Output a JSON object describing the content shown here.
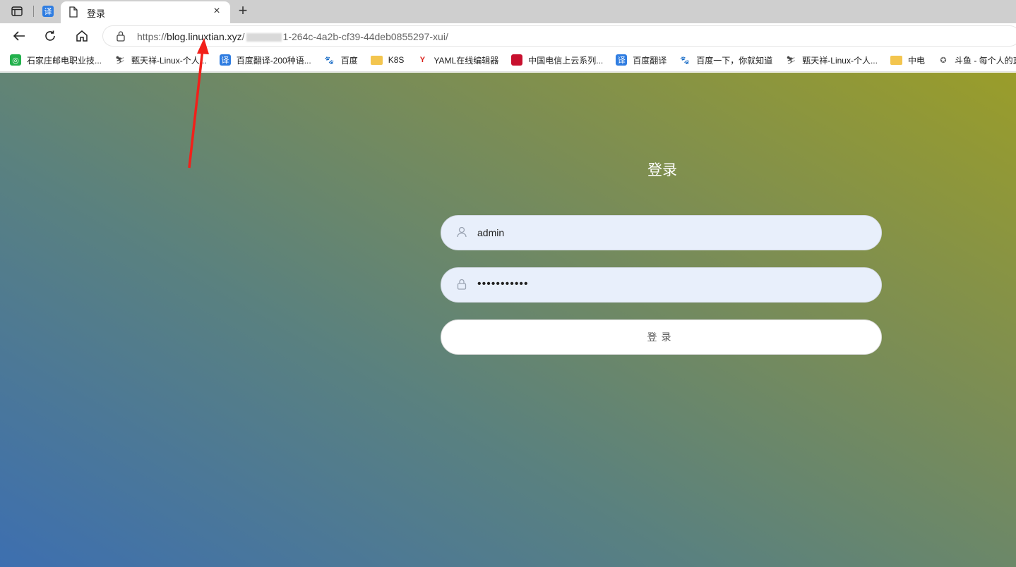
{
  "browser": {
    "tabs": [
      {
        "title": "登录",
        "active": true
      }
    ],
    "pinned_tab_icon": "translate-icon",
    "new_tab_symbol": "+",
    "close_symbol": "×",
    "address": {
      "scheme": "https://",
      "host": "blog.linuxtian.xyz",
      "path_start": "/",
      "path_end": "1-264c-4a2b-cf39-44deb0855297-xui/"
    },
    "bookmarks": [
      {
        "label": "石家庄邮电职业技...",
        "icon": "green-circle-icon"
      },
      {
        "label": "甄天祥-Linux-个人...",
        "icon": "penguin-icon"
      },
      {
        "label": "百度翻译-200种语...",
        "icon": "translate-icon"
      },
      {
        "label": "百度",
        "icon": "baidu-paw-icon"
      },
      {
        "label": "K8S",
        "icon": "folder-icon"
      },
      {
        "label": "YAML在线编辑器",
        "icon": "yaml-icon"
      },
      {
        "label": "中国电信上云系列...",
        "icon": "telecom-icon"
      },
      {
        "label": "百度翻译",
        "icon": "translate-icon"
      },
      {
        "label": "百度一下，你就知道",
        "icon": "baidu-paw-icon"
      },
      {
        "label": "甄天祥-Linux-个人...",
        "icon": "penguin-icon"
      },
      {
        "label": "中电",
        "icon": "folder-icon"
      },
      {
        "label": "斗鱼 - 每个人的直...",
        "icon": "douyu-icon"
      }
    ]
  },
  "login": {
    "title": "登录",
    "username_value": "admin",
    "password_mask": "•••••••••••",
    "submit_label": "登录"
  },
  "colors": {
    "gradient_start": "#3d6fb0",
    "gradient_end": "#9a9d2a",
    "annotation_arrow": "#f2201a",
    "input_bg": "#e8effb"
  }
}
